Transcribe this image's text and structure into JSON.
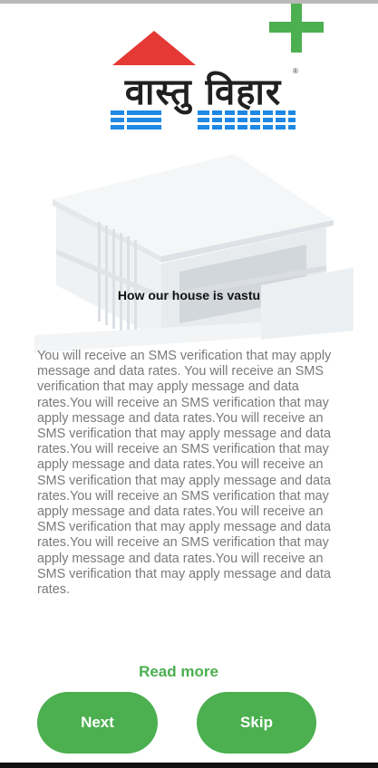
{
  "colors": {
    "accent": "#4caf50",
    "logo_roof": "#e53935",
    "logo_water": "#1e88e5",
    "body_text": "#7a7a7a"
  },
  "header": {
    "add_icon": "plus-icon"
  },
  "logo": {
    "text": "वास्तु विहार",
    "registered": "®"
  },
  "illustration": {
    "icon": "house-illustration"
  },
  "content": {
    "headline": "How our house is vastu",
    "body": "You will receive an SMS verification that may apply message and data rates. You will receive an SMS verification that may apply message and data rates.You will receive an SMS verification that may apply message and data rates.You will receive an SMS verification that may apply message and data rates.You will receive an SMS verification that may apply message and data rates.You will receive an SMS verification that may apply message and data rates.You will receive an SMS verification that may apply message and data rates.You will receive an SMS verification that may apply message and data rates.You will receive an SMS verification that may apply message and data rates.You will receive an SMS verification that may apply message and data rates.",
    "read_more": "Read more"
  },
  "actions": {
    "next_label": "Next",
    "skip_label": "Skip"
  }
}
